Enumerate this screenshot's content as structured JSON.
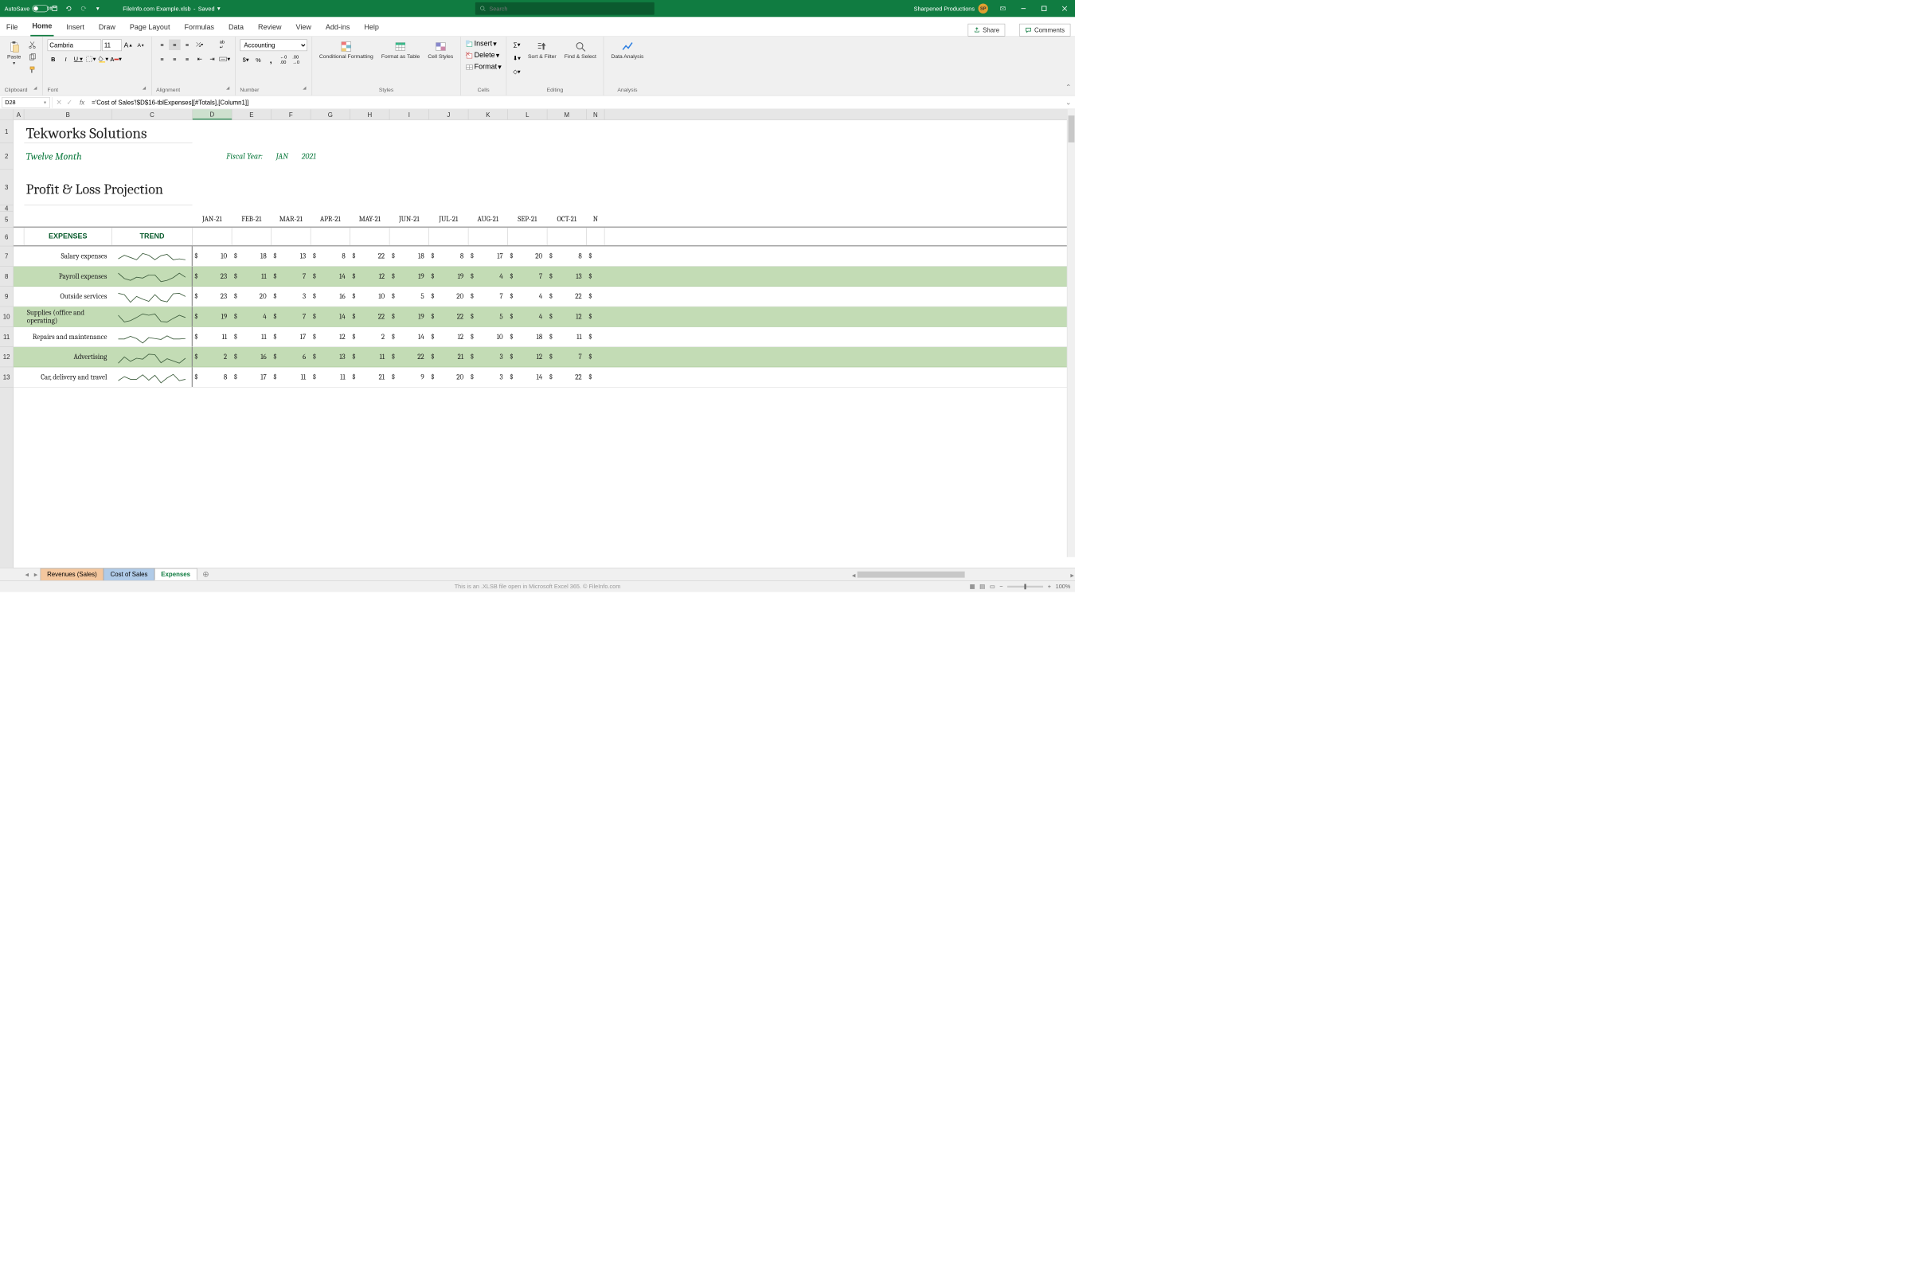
{
  "titlebar": {
    "autosave_label": "AutoSave",
    "autosave_state": "Off",
    "filename": "FileInfo.com Example.xlsb",
    "saved_state": "Saved",
    "search_placeholder": "Search",
    "account": "Sharpened Productions",
    "account_initials": "SP"
  },
  "tabs": [
    "File",
    "Home",
    "Insert",
    "Draw",
    "Page Layout",
    "Formulas",
    "Data",
    "Review",
    "View",
    "Add-ins",
    "Help"
  ],
  "active_tab": "Home",
  "share": "Share",
  "comments": "Comments",
  "ribbon": {
    "clipboard": "Clipboard",
    "paste": "Paste",
    "font": "Font",
    "font_name": "Cambria",
    "font_size": "11",
    "alignment": "Alignment",
    "number": "Number",
    "number_format": "Accounting",
    "styles": "Styles",
    "cond_fmt": "Conditional Formatting",
    "fmt_table": "Format as Table",
    "cell_styles": "Cell Styles",
    "cells": "Cells",
    "insert": "Insert",
    "delete": "Delete",
    "format": "Format",
    "editing": "Editing",
    "sort_filter": "Sort & Filter",
    "find_select": "Find & Select",
    "analysis": "Analysis",
    "data_analysis": "Data Analysis"
  },
  "namebox": "D28",
  "formula": "='Cost of Sales'!$D$16-tblExpenses[[#Totals],[Column1]]",
  "cols": [
    "A",
    "B",
    "C",
    "D",
    "E",
    "F",
    "G",
    "H",
    "I",
    "J",
    "K",
    "L",
    "M",
    "N"
  ],
  "rows": [
    "1",
    "2",
    "3",
    "4",
    "5",
    "6",
    "7",
    "8",
    "9",
    "10",
    "11",
    "12",
    "13"
  ],
  "doc": {
    "company": "Tekworks Solutions",
    "period": "Twelve Month",
    "title": "Profit & Loss Projection",
    "fy_label": "Fiscal Year:",
    "fy_month": "JAN",
    "fy_year": "2021"
  },
  "months": [
    "JAN-21",
    "FEB-21",
    "MAR-21",
    "APR-21",
    "MAY-21",
    "JUN-21",
    "JUL-21",
    "AUG-21",
    "SEP-21",
    "OCT-21",
    "N"
  ],
  "hdr": {
    "expenses": "EXPENSES",
    "trend": "TREND"
  },
  "exp": [
    {
      "name": "Salary expenses",
      "v": [
        10,
        18,
        13,
        8,
        22,
        18,
        8,
        17,
        20,
        8
      ]
    },
    {
      "name": "Payroll expenses",
      "v": [
        23,
        11,
        7,
        14,
        12,
        19,
        19,
        4,
        7,
        13
      ]
    },
    {
      "name": "Outside services",
      "v": [
        23,
        20,
        3,
        16,
        10,
        5,
        20,
        7,
        4,
        22
      ]
    },
    {
      "name": "Supplies (office and operating)",
      "v": [
        19,
        4,
        7,
        14,
        22,
        19,
        22,
        5,
        4,
        12
      ]
    },
    {
      "name": "Repairs and maintenance",
      "v": [
        11,
        11,
        17,
        12,
        2,
        14,
        12,
        10,
        18,
        11
      ]
    },
    {
      "name": "Advertising",
      "v": [
        2,
        16,
        6,
        13,
        11,
        22,
        21,
        3,
        12,
        7
      ]
    },
    {
      "name": "Car, delivery and travel",
      "v": [
        8,
        17,
        11,
        11,
        21,
        9,
        20,
        3,
        14,
        22
      ]
    }
  ],
  "sheet_tabs": [
    {
      "name": "Revenues (Sales)",
      "color": "#f4c79e"
    },
    {
      "name": "Cost of Sales",
      "color": "#b0cbe8"
    },
    {
      "name": "Expenses",
      "color": "#fff",
      "active": true
    }
  ],
  "status": "This is an .XLSB file open in Microsoft Excel 365. © FileInfo.com",
  "zoom": "100%"
}
